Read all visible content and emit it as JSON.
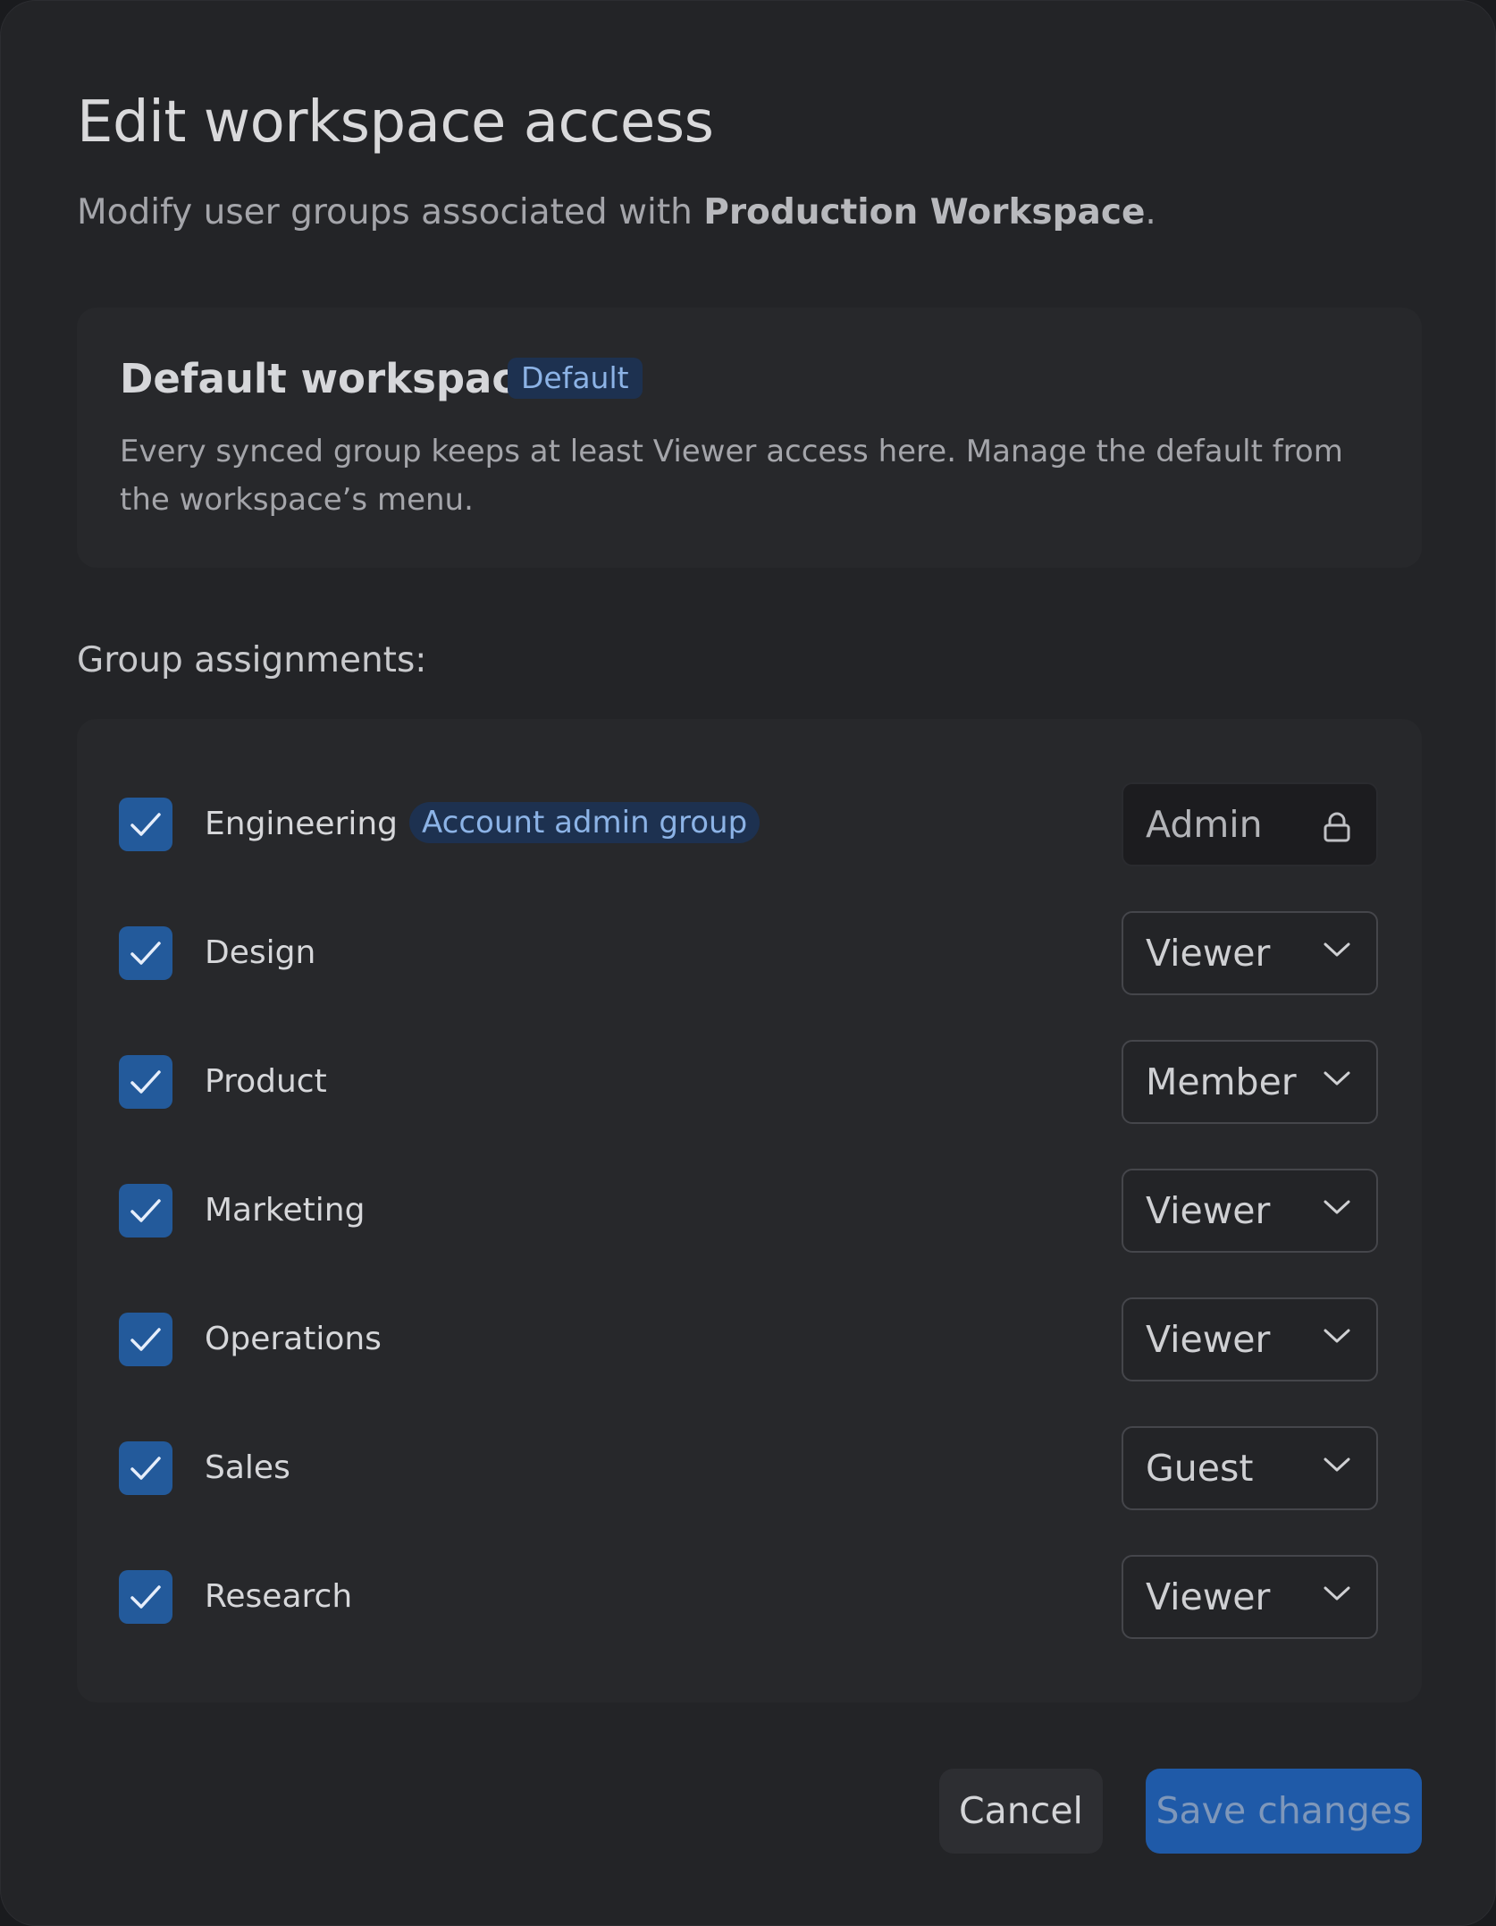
{
  "dialog": {
    "title": "Edit workspace access",
    "subtitle_prefix": "Modify user groups associated with ",
    "subtitle_workspace": "Production Workspace",
    "subtitle_suffix": "."
  },
  "default_workspace": {
    "title": "Default workspace",
    "badge": "Default",
    "description": "Every synced group keeps at least Viewer access here. Manage the default from the workspace’s menu."
  },
  "groups": {
    "label": "Group assignments:",
    "items": [
      {
        "name": "Engineering",
        "badge": "Account admin group",
        "role": "Admin",
        "checked": true,
        "locked": true
      },
      {
        "name": "Design",
        "role": "Viewer",
        "checked": true,
        "locked": false
      },
      {
        "name": "Product",
        "role": "Member",
        "checked": true,
        "locked": false
      },
      {
        "name": "Marketing",
        "role": "Viewer",
        "checked": true,
        "locked": false
      },
      {
        "name": "Operations",
        "role": "Viewer",
        "checked": true,
        "locked": false
      },
      {
        "name": "Sales",
        "role": "Guest",
        "checked": true,
        "locked": false
      },
      {
        "name": "Research",
        "role": "Viewer",
        "checked": true,
        "locked": false
      }
    ]
  },
  "footer": {
    "cancel_label": "Cancel",
    "save_label": "Save changes"
  },
  "colors": {
    "background": "#232427",
    "accent": "#235a9b",
    "badge_bg": "#1d3150",
    "badge_text": "#8cb3e6"
  },
  "icons": {
    "checkbox": "check-icon",
    "locked_role": "lock-icon",
    "role_dropdown": "chevron-down-icon"
  }
}
